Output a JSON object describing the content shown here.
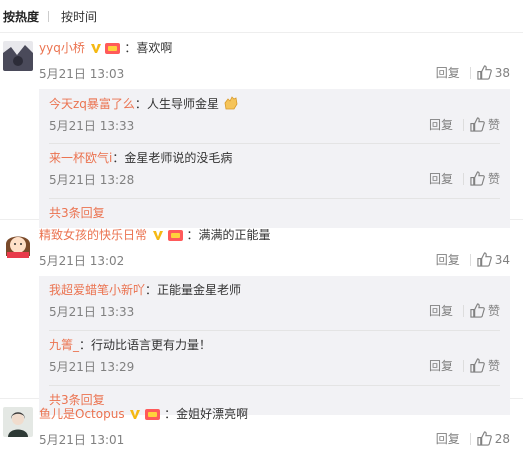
{
  "sort": {
    "hot": "按热度",
    "time": "按时间"
  },
  "comments": [
    {
      "user": "yyq小桥",
      "colon": "：",
      "text": "喜欢啊",
      "time": "5月21日 13:03",
      "reply_label": "回复",
      "likes": "38",
      "avatar_color": "#5a5a6a",
      "replies": [
        {
          "user": "今天zq暴富了么",
          "colon": "：",
          "text": "人生导师金星",
          "emoji": "clapping-hands-icon",
          "time": "5月21日 13:33",
          "reply_label": "回复",
          "like_label": "赞"
        },
        {
          "user": "来一杯欧气i",
          "colon": "：",
          "text": "金星老师说的没毛病",
          "time": "5月21日 13:28",
          "reply_label": "回复",
          "like_label": "赞"
        }
      ],
      "more": "共3条回复"
    },
    {
      "user": "精致女孩的快乐日常",
      "colon": "：",
      "text": "满满的正能量",
      "time": "5月21日 13:02",
      "reply_label": "回复",
      "likes": "34",
      "avatar_color": "#f2c4b8",
      "replies": [
        {
          "user": "我超爱蜡笔小新吖",
          "colon": "：",
          "text": "正能量金星老师",
          "time": "5月21日 13:33",
          "reply_label": "回复",
          "like_label": "赞"
        },
        {
          "user": "九箐_",
          "colon": "：",
          "text": "行动比语言更有力量！",
          "time": "5月21日 13:29",
          "reply_label": "回复",
          "like_label": "赞"
        }
      ],
      "more": "共3条回复"
    },
    {
      "user": "鱼儿是Octopus",
      "colon": "：",
      "text": "金姐好漂亮啊",
      "time": "5月21日 13:01",
      "reply_label": "回复",
      "likes": "28",
      "avatar_color": "#cfd6d0",
      "replies": []
    }
  ],
  "colors": {
    "accent": "#eb7350",
    "meta": "#808080",
    "reply_bg": "#f2f2f5"
  }
}
